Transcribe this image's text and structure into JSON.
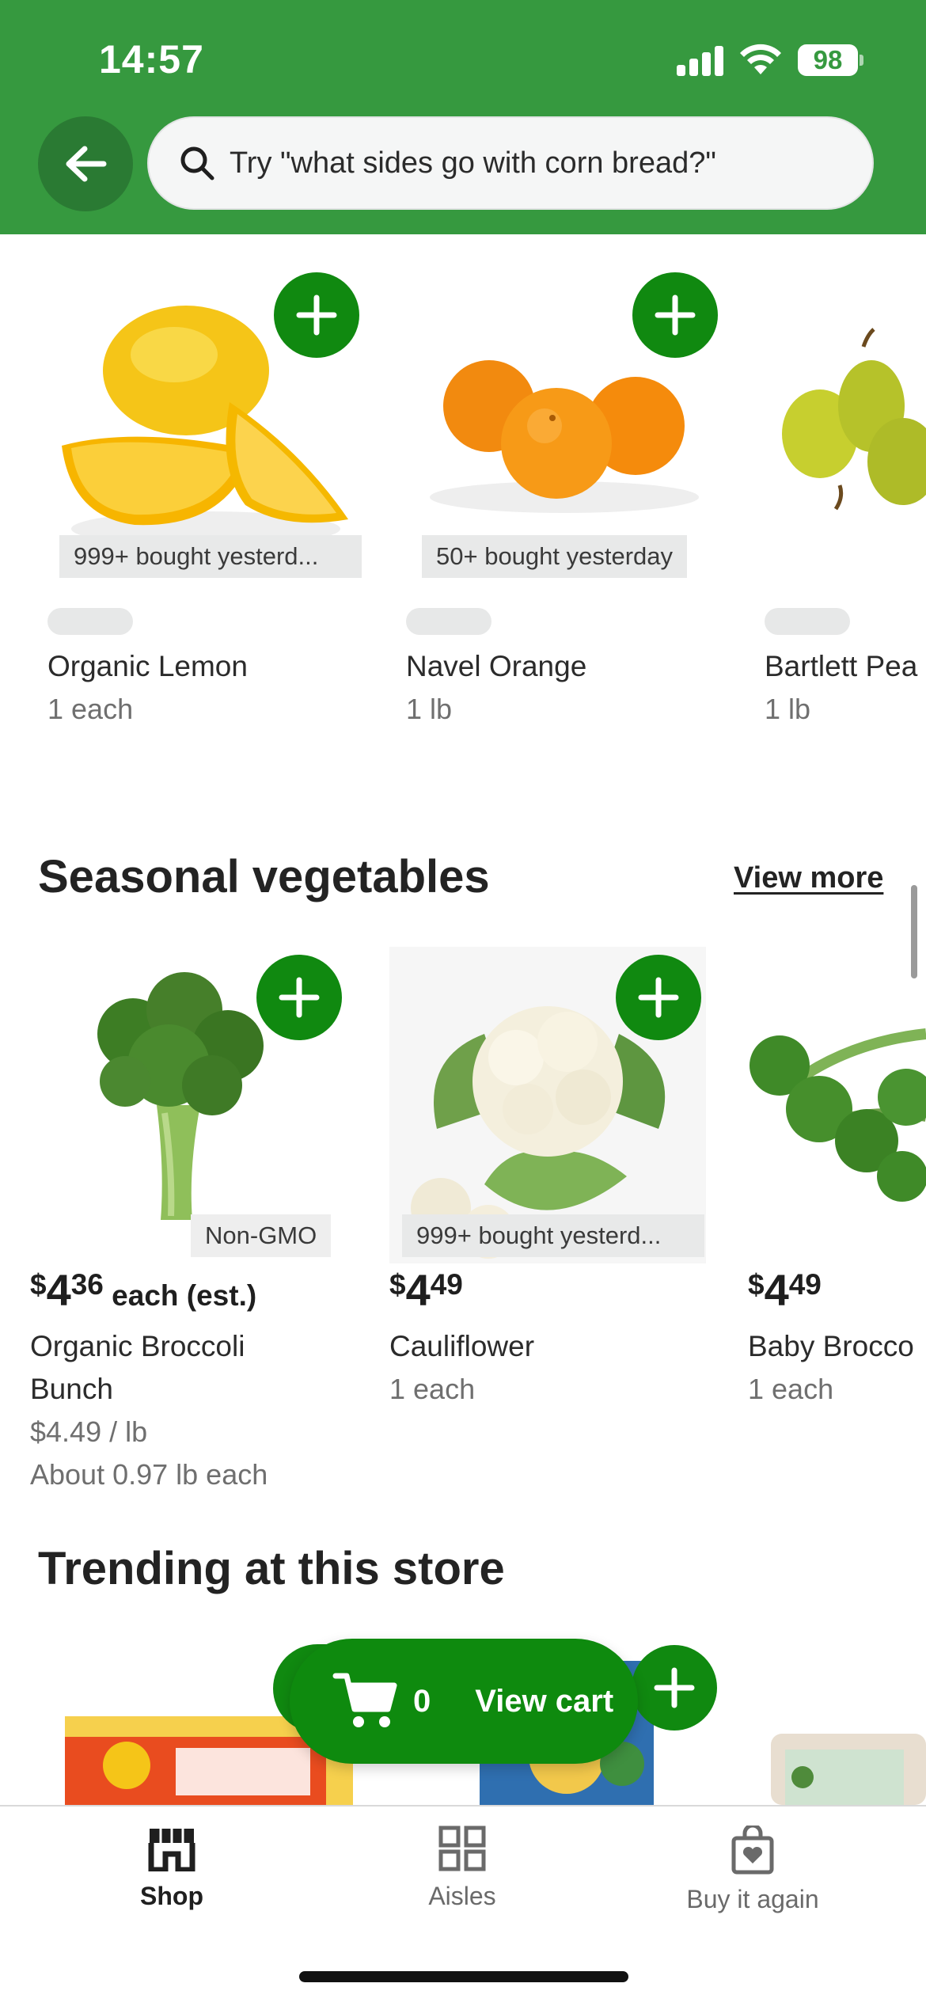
{
  "status_bar": {
    "time": "14:57",
    "battery": "98"
  },
  "header": {
    "search_placeholder": "Try \"what sides go with corn bread?\"",
    "back_icon": "arrow-left-icon"
  },
  "fruits": [
    {
      "badge": "999+ bought yesterd...",
      "name": "Organic Lemon",
      "unit": "1 each"
    },
    {
      "badge": "50+ bought yesterday",
      "name": "Navel Orange",
      "unit": "1 lb"
    },
    {
      "name": "Bartlett Pea",
      "unit": "1 lb"
    }
  ],
  "seasonal": {
    "title": "Seasonal vegetables",
    "view_more": "View more",
    "items": [
      {
        "badge": "Non-GMO",
        "price_dollar": "$",
        "price_main": "4",
        "price_cents": "36",
        "price_suffix": " each (est.)",
        "name_line1": "Organic Broccoli",
        "name_line2": "Bunch",
        "per_lb": "$4.49 / lb",
        "about": "About 0.97 lb each"
      },
      {
        "badge": "999+ bought yesterd...",
        "price_dollar": "$",
        "price_main": "4",
        "price_cents": "49",
        "name": "Cauliflower",
        "unit": "1 each"
      },
      {
        "price_dollar": "$",
        "price_main": "4",
        "price_cents": "49",
        "name": "Baby Brocco",
        "unit": "1 each"
      }
    ]
  },
  "trending": {
    "title": "Trending at this store"
  },
  "cart": {
    "count": "0",
    "label": "View cart"
  },
  "tabs": [
    {
      "label": "Shop",
      "icon": "store-icon",
      "active": true
    },
    {
      "label": "Aisles",
      "icon": "grid-icon",
      "active": false
    },
    {
      "label": "Buy it again",
      "icon": "shopping-bag-heart-icon",
      "active": false
    }
  ],
  "colors": {
    "brand_green": "#36993f",
    "button_green": "#108910"
  }
}
